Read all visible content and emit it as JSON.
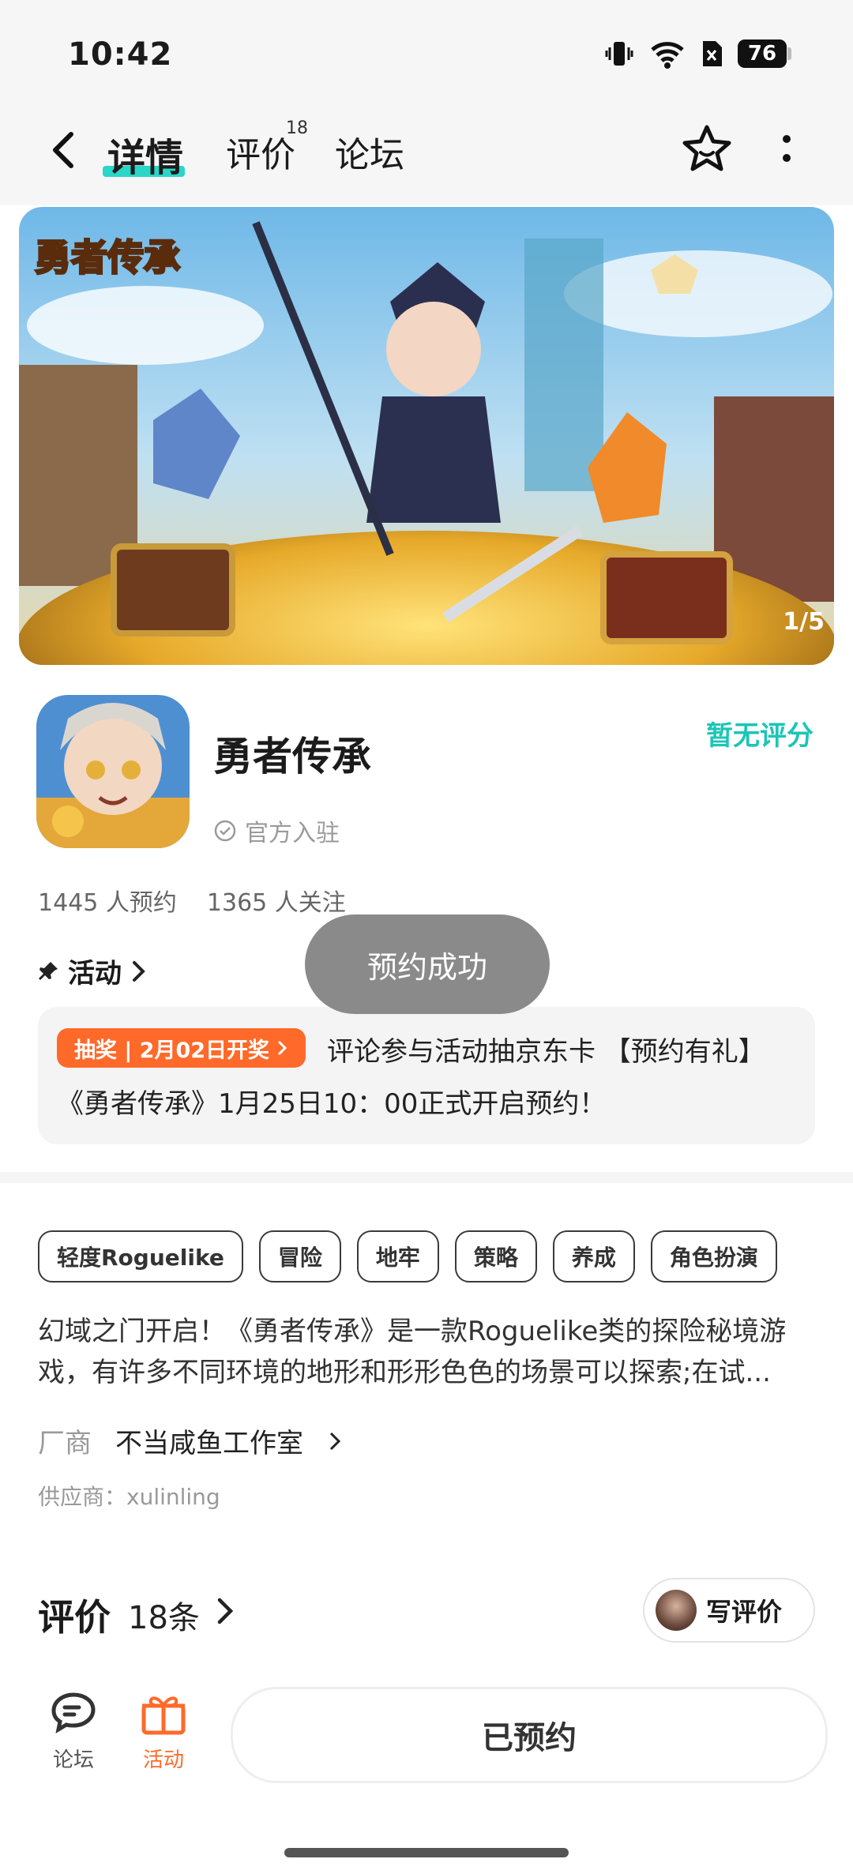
{
  "status_bar": {
    "time": "10:42",
    "battery": "76"
  },
  "nav": {
    "tabs": [
      {
        "label": "详情",
        "active": true
      },
      {
        "label": "评价",
        "badge": "18"
      },
      {
        "label": "论坛"
      }
    ]
  },
  "banner": {
    "logo_text": "勇者传承",
    "page_indicator": "1/5"
  },
  "app": {
    "name": "勇者传承",
    "rating_text": "暂无评分",
    "official_label": "官方入驻",
    "reservations": "1445 人预约",
    "followers": "1365 人关注"
  },
  "toast": "预约成功",
  "activity": {
    "section_label": "活动",
    "badge": "抽奖 | 2月02日开奖",
    "line1": "评论参与活动抽京东卡 【预约有礼】",
    "line2": "《勇者传承》1月25日10：00正式开启预约！"
  },
  "tags": [
    "轻度Roguelike",
    "冒险",
    "地牢",
    "策略",
    "养成",
    "角色扮演"
  ],
  "description": "幻域之门开启！《勇者传承》是一款Roguelike类的探险秘境游戏，有许多不同环境的地形和形形色色的场景可以探索;在试...",
  "vendor": {
    "label": "厂商",
    "name": "不当咸鱼工作室"
  },
  "supplier": "供应商：xulinling",
  "reviews": {
    "title": "评价",
    "count": "18条",
    "write_label": "写评价"
  },
  "bottom_bar": {
    "forum_label": "论坛",
    "activity_label": "活动",
    "reserve_label": "已预约"
  },
  "colors": {
    "accent": "#2ad6c8",
    "rating": "#1cc5b6",
    "activity": "#ff6a2a"
  }
}
